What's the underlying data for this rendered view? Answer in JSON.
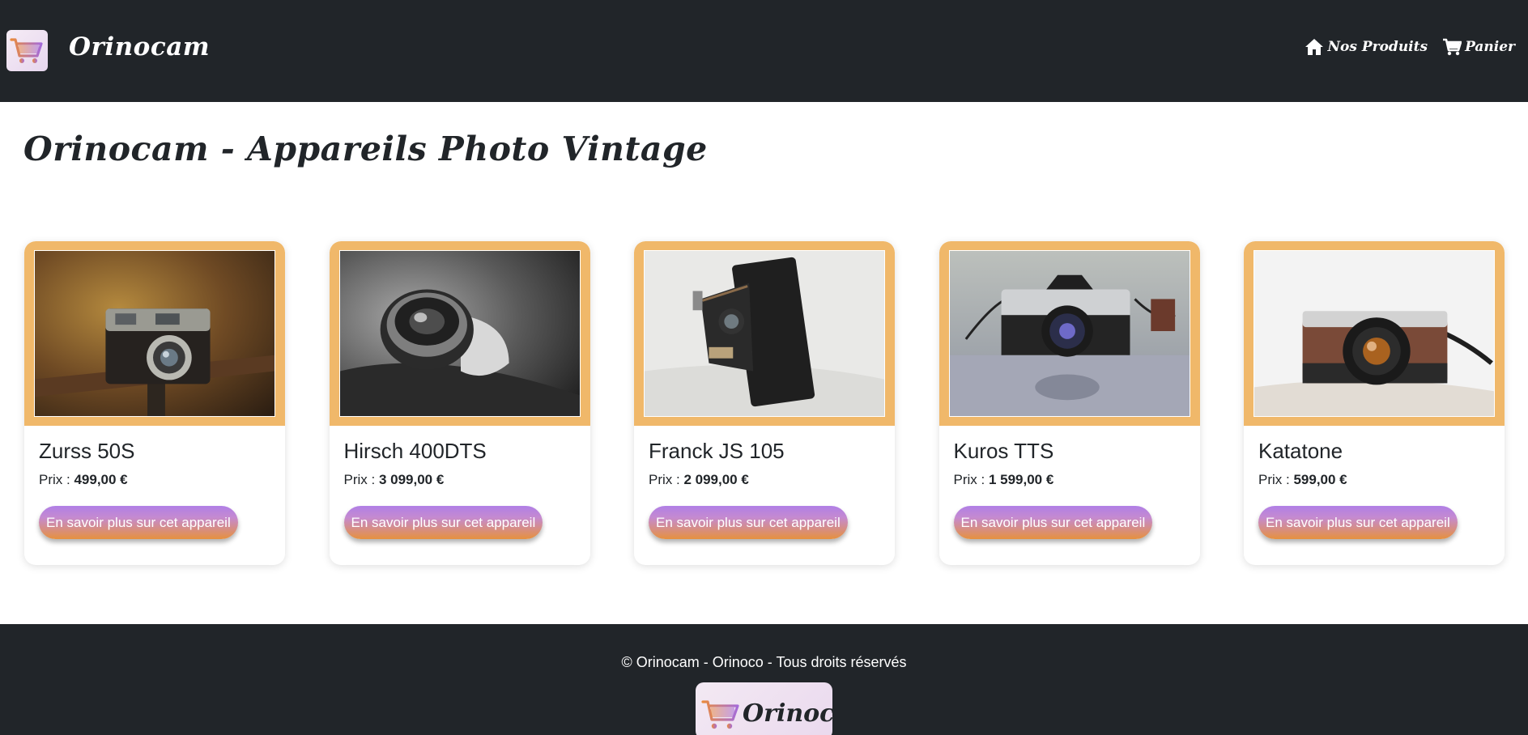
{
  "header": {
    "brand": "Orinocam",
    "nav": [
      {
        "label": "Nos Produits",
        "icon": "home-icon"
      },
      {
        "label": "Panier",
        "icon": "cart-icon"
      }
    ]
  },
  "main": {
    "title": "Orinocam - Appareils Photo Vintage",
    "price_label": "Prix :",
    "products": [
      {
        "name": "Zurss 50S",
        "price": "499,00 €",
        "button": "En savoir plus sur cet appareil",
        "image": "vintage-camera-on-rail-photo"
      },
      {
        "name": "Hirsch 400DTS",
        "price": "3 099,00 €",
        "button": "En savoir plus sur cet appareil",
        "image": "black-white-lens-photo"
      },
      {
        "name": "Franck JS 105",
        "price": "2 099,00 €",
        "button": "En savoir plus sur cet appareil",
        "image": "folding-camera-photo"
      },
      {
        "name": "Kuros TTS",
        "price": "1 599,00 €",
        "button": "En savoir plus sur cet appareil",
        "image": "minolta-camera-photo"
      },
      {
        "name": "Katatone",
        "price": "599,00 €",
        "button": "En savoir plus sur cet appareil",
        "image": "brown-leather-camera-photo"
      }
    ]
  },
  "footer": {
    "copyright": "© Orinocam - Orinoco - Tous droits réservés",
    "logo_text": "Orinoco"
  },
  "colors": {
    "navbar": "#212529",
    "card_frame": "#f0b86a",
    "button_gradient_top": "#b07fe6",
    "button_gradient_bottom": "#e6913f"
  }
}
